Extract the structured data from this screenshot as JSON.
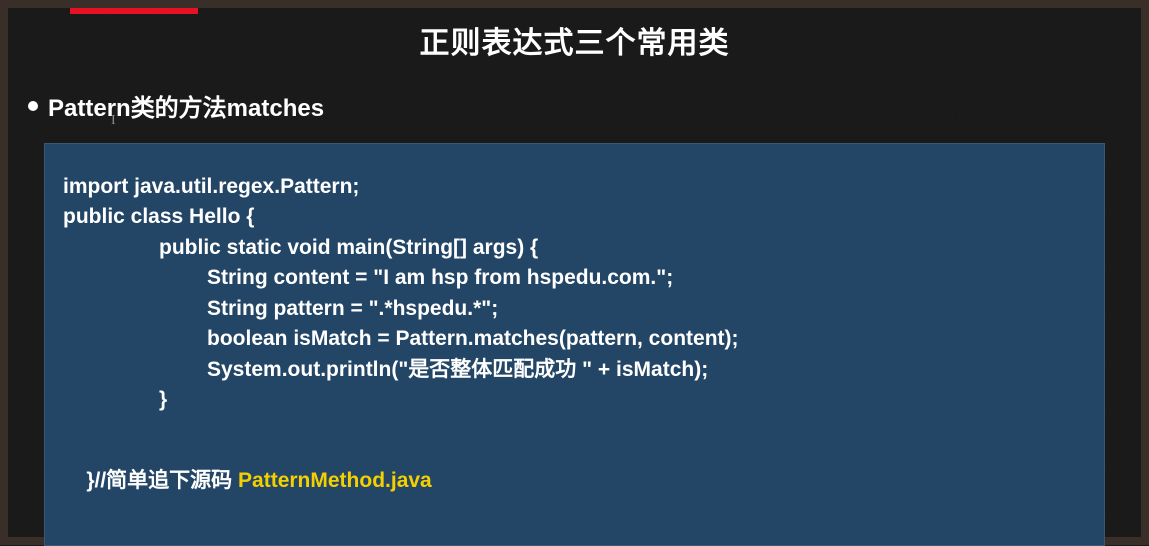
{
  "title": "正则表达式三个常用类",
  "bullet": {
    "text": "Pattern类的方法matches"
  },
  "code": {
    "line1": "import java.util.regex.Pattern;",
    "line2": "public class Hello {",
    "line3": "public static void main(String[] args) {",
    "line4": "String content = \"I am hsp from hspedu.com.\";",
    "line5": "String pattern = \".*hspedu.*\";",
    "line6": "boolean isMatch = Pattern.matches(pattern, content);",
    "line7": "System.out.println(\"是否整体匹配成功 \" + isMatch);",
    "line8": "}",
    "comment_prefix": "}//简单追下源码 ",
    "comment_file": "PatternMethod.java"
  }
}
